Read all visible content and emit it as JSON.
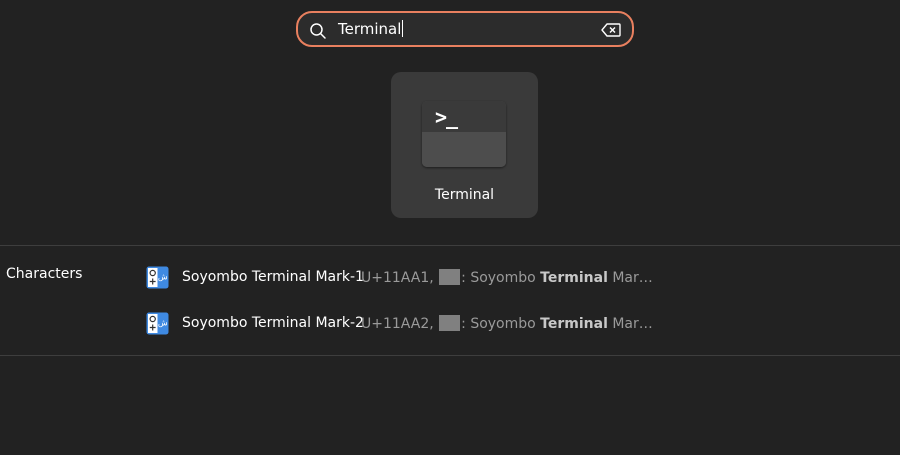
{
  "search": {
    "query": "Terminal"
  },
  "app_result": {
    "icon_prompt": ">_",
    "name": "Terminal"
  },
  "characters": {
    "provider_label": "Characters",
    "results": [
      {
        "title": "Soyombo Terminal Mark-1",
        "code": "U+11AA1,",
        "desc_prefix": ": Soyombo ",
        "desc_highlight": "Terminal",
        "desc_suffix": " Mar…"
      },
      {
        "title": "Soyombo Terminal Mark-2",
        "code": "U+11AA2,",
        "desc_prefix": ": Soyombo ",
        "desc_highlight": "Terminal",
        "desc_suffix": " Mar…"
      }
    ]
  },
  "colors": {
    "background": "#222222",
    "search_border_focus": "#e9805f",
    "tile_background": "#3a3a3a",
    "char_icon_blue": "#3f8ae2"
  }
}
